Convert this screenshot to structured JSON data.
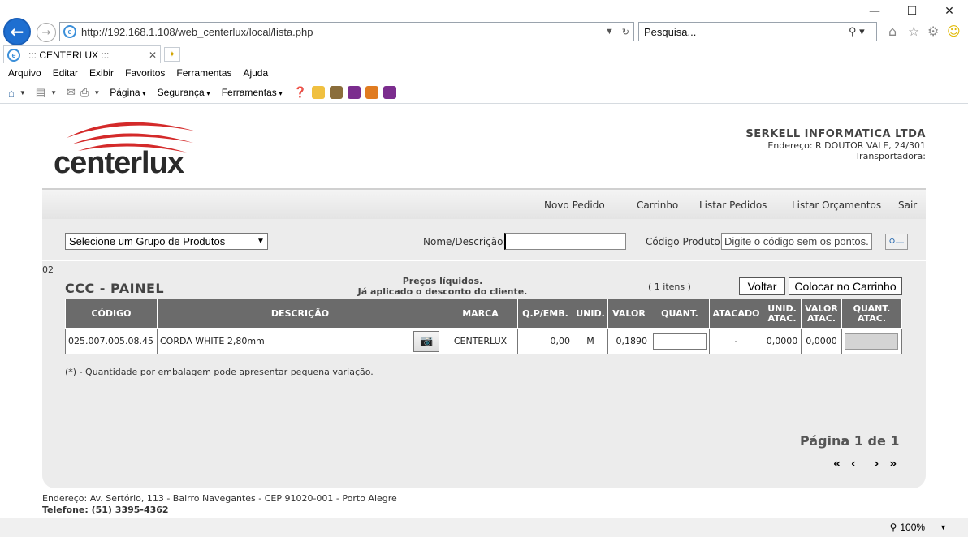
{
  "browser": {
    "url": "http://192.168.1.108/web_centerlux/local/lista.php",
    "search_placeholder": "Pesquisa...",
    "tab_title": "::: CENTERLUX :::",
    "menu": [
      "Arquivo",
      "Editar",
      "Exibir",
      "Favoritos",
      "Ferramentas",
      "Ajuda"
    ],
    "command_items": [
      "Página",
      "Segurança",
      "Ferramentas"
    ],
    "zoom": "100%"
  },
  "header": {
    "logo_text": "centerlux",
    "company_name": "SERKELL INFORMATICA LTDA",
    "address_line": "Endereço: R DOUTOR VALE, 24/301",
    "shipper_line": "Transportadora:"
  },
  "nav": {
    "new_order": "Novo Pedido",
    "cart": "Carrinho",
    "list_orders": "Listar Pedidos",
    "list_quotes": "Listar Orçamentos",
    "exit": "Sair"
  },
  "filters": {
    "group_select": "Selecione um Grupo de Produtos",
    "name_label": "Nome/Descrição:",
    "name_value": "",
    "code_label": "Código Produto:",
    "code_placeholder": "Digite o código sem os pontos."
  },
  "section": {
    "code": "02",
    "title": "CCC - PAINEL",
    "note_line1": "Preços líquidos.",
    "note_line2": "Já aplicado o desconto do cliente.",
    "items_count": "( 1 itens )",
    "back_button": "Voltar",
    "add_cart_button": "Colocar no Carrinho"
  },
  "table": {
    "headers": [
      "CÓDIGO",
      "DESCRIÇÃO",
      "MARCA",
      "Q.P/EMB.",
      "UNID.",
      "VALOR",
      "QUANT.",
      "ATACADO",
      "UNID. ATAC.",
      "VALOR ATAC.",
      "QUANT. ATAC."
    ],
    "rows": [
      {
        "code": "025.007.005.08.45",
        "description": "CORDA WHITE 2,80mm",
        "brand": "CENTERLUX",
        "qty_per_pack": "0,00",
        "unit": "M",
        "price": "0,1890",
        "wholesale": "-",
        "wholesale_unit": "0,0000",
        "wholesale_price": "0,0000"
      }
    ]
  },
  "footnote": "(*) - Quantidade por embalagem pode apresentar pequena variação.",
  "pagination": {
    "text": "Página 1 de 1",
    "first": "«",
    "prev": "‹",
    "next": "›",
    "last": "»"
  },
  "footer": {
    "address": "Endereço: Av. Sertório, 113 - Bairro Navegantes - CEP 91020-001 - Porto Alegre",
    "phone": "Telefone: (51) 3395-4362"
  },
  "colors": {
    "logo_red": "#d42a2a",
    "table_header": "#6b6b6b",
    "panel_bg": "#ececec"
  }
}
